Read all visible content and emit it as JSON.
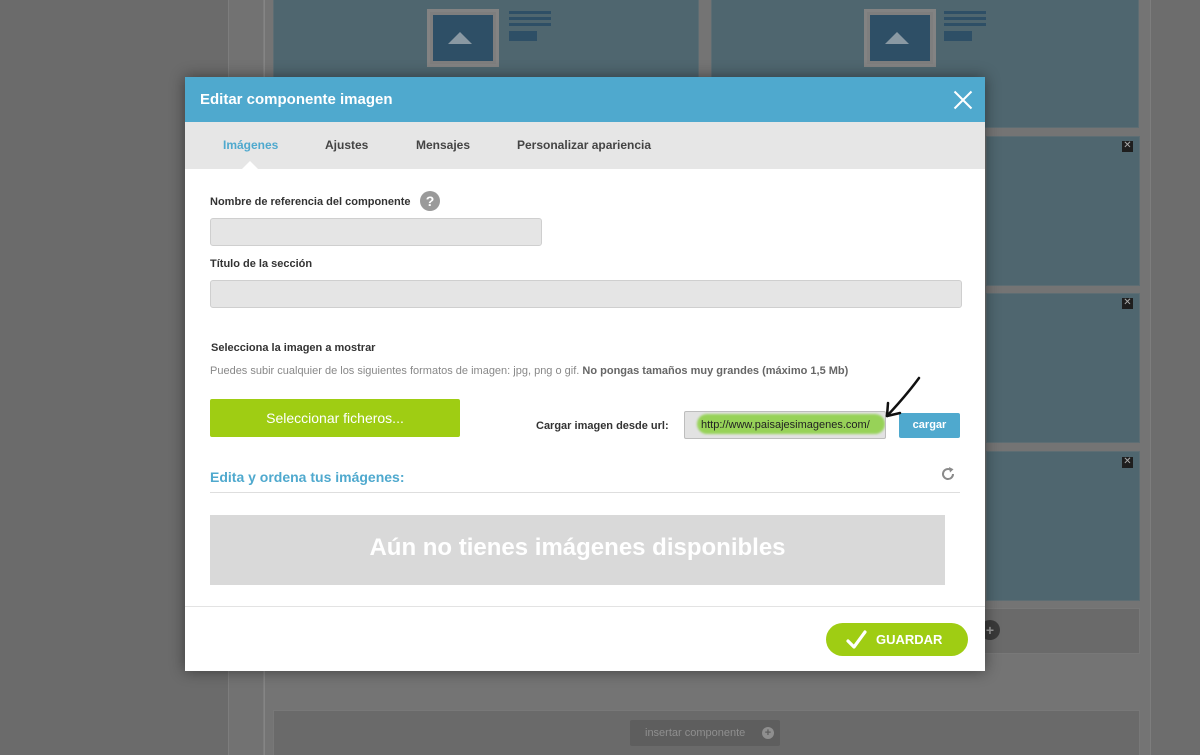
{
  "background": {
    "insert_label": "insertar componente",
    "close_mark": "✕",
    "plus_mark": "+"
  },
  "modal": {
    "title": "Editar componente imagen",
    "tabs": [
      {
        "label": "Imágenes",
        "active": true
      },
      {
        "label": "Ajustes",
        "active": false
      },
      {
        "label": "Mensajes",
        "active": false
      },
      {
        "label": "Personalizar apariencia",
        "active": false
      }
    ],
    "form": {
      "ref_name_label": "Nombre de referencia del componente",
      "help_mark": "?",
      "ref_name_value": "",
      "section_title_label": "Título de la sección",
      "section_title_value": "",
      "select_image_label": "Selecciona la imagen a mostrar",
      "formats_hint": "Puedes subir cualquier de los siguientes formatos de imagen: jpg, png o gif.",
      "formats_hint_bold": "No pongas tamaños muy grandes (máximo 1,5 Mb)",
      "select_files_button": "Seleccionar ficheros...",
      "url_label": "Cargar imagen desde url:",
      "url_value": "http://www.paisajesimagenes.com/",
      "load_button": "cargar"
    },
    "gallery": {
      "title": "Edita y ordena tus imágenes:",
      "empty_message": "Aún no tienes imágenes disponibles"
    },
    "footer": {
      "save_button": "GUARDAR"
    }
  },
  "colors": {
    "accent_blue": "#4fa9ce",
    "accent_green": "#9fcd13",
    "overlay": "#6f6f6f"
  }
}
